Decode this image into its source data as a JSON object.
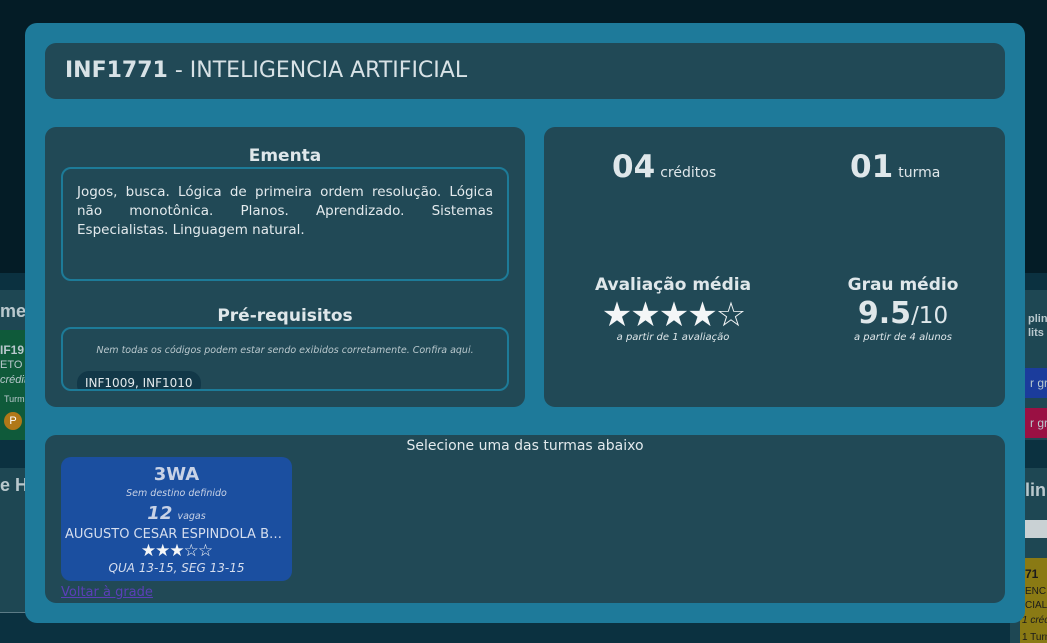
{
  "background": {
    "left_texts": [
      "me",
      "IF19",
      "ETO E",
      "crédit",
      "Turm",
      "P",
      "e H"
    ],
    "right_texts": [
      "plina",
      "lits",
      "r gra",
      "r gra",
      "lin",
      "71",
      "ENC",
      "CIAL",
      "1 créditos",
      "1 Turmas"
    ]
  },
  "modal": {
    "course_code": "INF1771",
    "course_separator": " - ",
    "course_name": "INTELIGENCIA ARTIFICIAL",
    "ementa": {
      "title": "Ementa",
      "text": "Jogos, busca. Lógica de primeira ordem resolução. Lógica não monotônica. Planos. Aprendizado. Sistemas Especialistas. Linguagem natural."
    },
    "prerequisites": {
      "title": "Pré-requisitos",
      "note": "Nem todas os códigos podem estar sendo exibidos corretamente. Confira aqui.",
      "chip": "INF1009, INF1010"
    },
    "stats": {
      "credits_value": "04",
      "credits_unit": "créditos",
      "turmas_value": "01",
      "turmas_unit": "turma",
      "rating_title": "Avaliação média",
      "rating_stars": 4,
      "rating_max": 5,
      "rating_note": "a partir de 1 avaliação",
      "grade_title": "Grau médio",
      "grade_value": "9.5",
      "grade_max": "/10",
      "grade_note": "a partir de 4 alunos"
    },
    "turmas": {
      "select_label": "Selecione uma das turmas abaixo",
      "cards": [
        {
          "code": "3WA",
          "destination": "Sem destino definido",
          "vagas": "12",
          "vagas_label": "vagas",
          "professor": "AUGUSTO CESAR ESPINDOLA BAFFA",
          "stars": 3,
          "stars_max": 5,
          "schedule": "QUA 13-15, SEG 13-15"
        }
      ],
      "back_link": "Voltar à grade"
    }
  }
}
